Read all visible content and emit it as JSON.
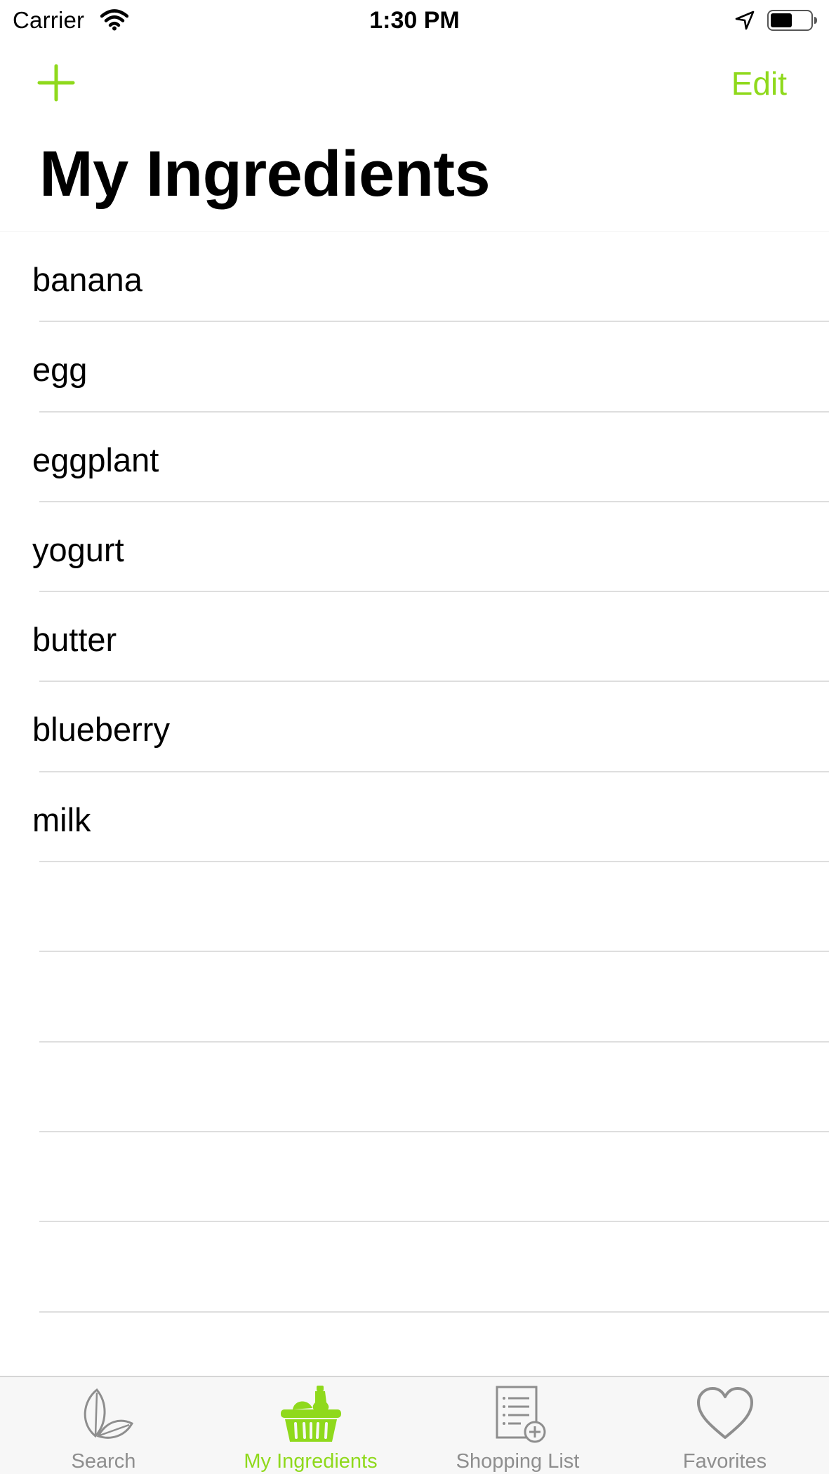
{
  "status_bar": {
    "carrier": "Carrier",
    "time": "1:30 PM"
  },
  "nav": {
    "edit_label": "Edit",
    "title": "My Ingredients"
  },
  "ingredients": [
    "banana",
    "egg",
    "eggplant",
    "yogurt",
    "butter",
    "blueberry",
    "milk"
  ],
  "tabs": [
    {
      "label": "Search",
      "icon": "leaf-icon",
      "active": false
    },
    {
      "label": "My Ingredients",
      "icon": "basket-icon",
      "active": true
    },
    {
      "label": "Shopping List",
      "icon": "list-add-icon",
      "active": false
    },
    {
      "label": "Favorites",
      "icon": "heart-icon",
      "active": false
    }
  ],
  "colors": {
    "accent": "#8fd91c",
    "inactive_tab": "#8e8e8e",
    "separator": "#dedede"
  }
}
